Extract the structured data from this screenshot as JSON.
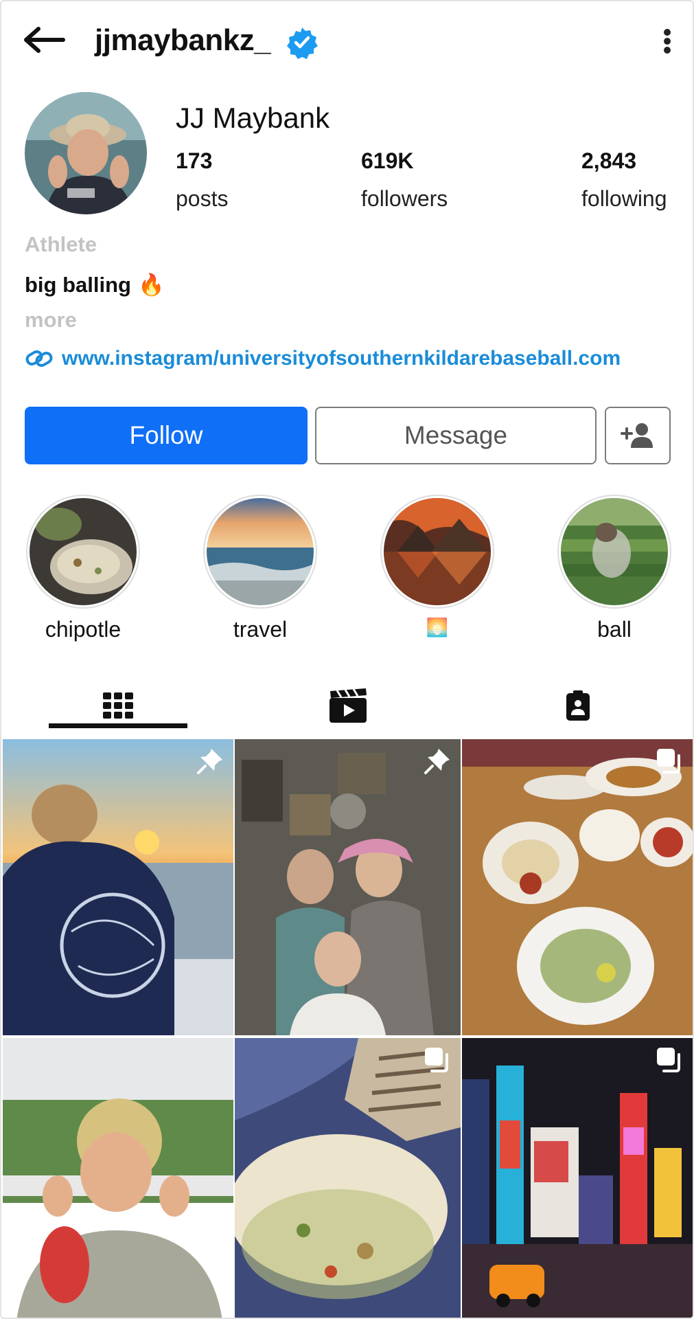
{
  "header": {
    "username": "jjmaybankz_",
    "icons": {
      "back": "arrow-left-icon",
      "verified": "verified-badge-icon",
      "more": "more-vertical-icon"
    }
  },
  "profile": {
    "name": "JJ Maybank",
    "stats": [
      {
        "value": "173",
        "label": "posts"
      },
      {
        "value": "619K",
        "label": "followers"
      },
      {
        "value": "2,843",
        "label": "following"
      }
    ],
    "category": "Athlete",
    "bio": "big balling",
    "bio_emoji": "🔥",
    "more": "more",
    "link": "www.instagram/universityofsouthernkildarebaseball.com"
  },
  "actions": {
    "follow": "Follow",
    "message": "Message",
    "add_user_icon": "person-add-icon"
  },
  "highlights": [
    {
      "label": "chipotle"
    },
    {
      "label": "travel"
    },
    {
      "label": "🌅"
    },
    {
      "label": "ball"
    }
  ],
  "tabs": [
    {
      "name": "posts-grid",
      "icon": "grid-icon",
      "active": true
    },
    {
      "name": "reels",
      "icon": "clapperboard-icon",
      "active": false
    },
    {
      "name": "tagged",
      "icon": "tagged-badge-icon",
      "active": false
    }
  ],
  "posts": [
    {
      "badge": "pin-icon"
    },
    {
      "badge": "pin-icon"
    },
    {
      "badge": "carousel-icon"
    },
    {
      "badge": ""
    },
    {
      "badge": "carousel-icon"
    },
    {
      "badge": "carousel-icon"
    }
  ],
  "colors": {
    "accent": "#0f6ff7",
    "link": "#1a8cd8",
    "verified": "#1d9bf0",
    "muted": "#c3c3c3"
  }
}
